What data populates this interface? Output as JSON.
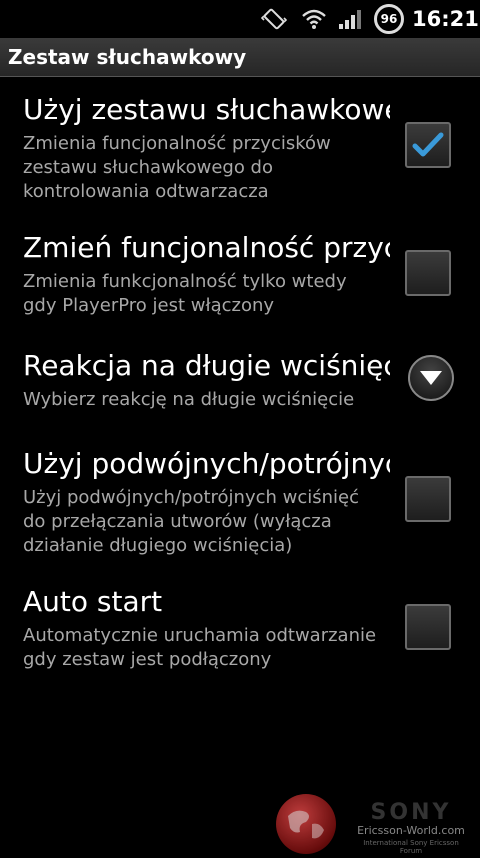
{
  "status_bar": {
    "battery_percent": "96",
    "time": "16:21",
    "icons": [
      "vibrate-icon",
      "wifi-icon",
      "signal-icon",
      "battery-icon"
    ]
  },
  "header": {
    "title": "Zestaw słuchawkowy"
  },
  "preferences": [
    {
      "title": "Użyj zestawu słuchawkowego",
      "summary": "Zmienia funcjonalność przycisków\nzestawu słuchawkowego do\nkontrolowania odtwarzacza",
      "control": "checkbox",
      "checked": true
    },
    {
      "title": "Zmień funcjonalność przycisków",
      "summary": "Zmienia funkcjonalność tylko wtedy\ngdy PlayerPro jest włączony",
      "control": "checkbox",
      "checked": false
    },
    {
      "title": "Reakcja na długie wciśnięcie",
      "summary": "Wybierz reakcję na długie wciśnięcie",
      "control": "dropdown"
    },
    {
      "title": "Użyj podwójnych/potrójnych wciśnięć",
      "summary": "Użyj podwójnych/potrójnych wciśnięć\ndo przełączania utworów (wyłącza\ndziałanie długiego wciśnięcia)",
      "control": "checkbox",
      "checked": false
    },
    {
      "title": "Auto start",
      "summary": "Automatycznie uruchamia odtwarzanie\ngdy zestaw jest podłączony",
      "control": "checkbox",
      "checked": false
    }
  ],
  "watermark": {
    "brand": "SONY",
    "site": "Ericsson-World.com",
    "tagline": "International Sony Ericsson Forum"
  },
  "colors": {
    "background": "#000000",
    "summary_text": "#a8a8a8",
    "check_accent": "#3a9ad9"
  }
}
